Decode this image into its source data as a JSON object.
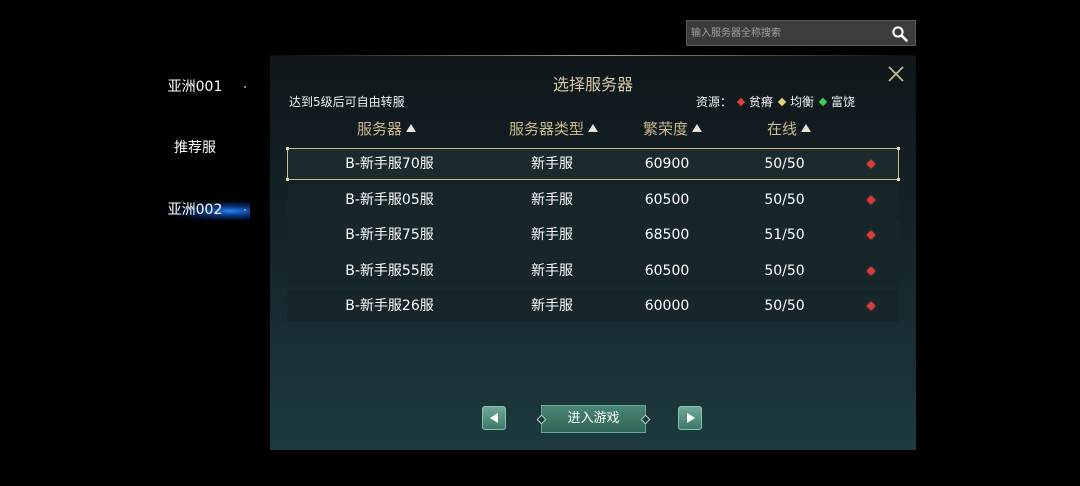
{
  "search": {
    "placeholder": "输入服务器全称搜索"
  },
  "nav": [
    {
      "label": "亚洲001",
      "active": false
    },
    {
      "label": "推荐服",
      "active": false
    },
    {
      "label": "亚洲002",
      "active": true
    }
  ],
  "panel": {
    "title": "选择服务器",
    "hint": "达到5级后可自由转服",
    "legend": {
      "label": "资源：",
      "items": [
        {
          "label": "贫瘠",
          "color": "#e23a3a"
        },
        {
          "label": "均衡",
          "color": "#e6d27a"
        },
        {
          "label": "富饶",
          "color": "#3ccf5a"
        }
      ]
    },
    "columns": [
      "服务器",
      "服务器类型",
      "繁荣度",
      "在线"
    ],
    "rows": [
      {
        "name": "B-新手服70服",
        "type": "新手服",
        "prosperity": "60900",
        "online": "50/50",
        "resource_color": "#e23a3a",
        "selected": true
      },
      {
        "name": "B-新手服05服",
        "type": "新手服",
        "prosperity": "60500",
        "online": "50/50",
        "resource_color": "#e23a3a",
        "selected": false
      },
      {
        "name": "B-新手服75服",
        "type": "新手服",
        "prosperity": "68500",
        "online": "51/50",
        "resource_color": "#e23a3a",
        "selected": false
      },
      {
        "name": "B-新手服55服",
        "type": "新手服",
        "prosperity": "60500",
        "online": "50/50",
        "resource_color": "#e23a3a",
        "selected": false
      },
      {
        "name": "B-新手服26服",
        "type": "新手服",
        "prosperity": "60000",
        "online": "50/50",
        "resource_color": "#e23a3a",
        "selected": false
      }
    ],
    "enter_label": "进入游戏"
  },
  "icons": {
    "search": "search-icon",
    "close": "close-icon",
    "prev": "arrow-left-icon",
    "next": "arrow-right-icon",
    "sort": "sort-up-icon",
    "resource": "diamond-icon"
  }
}
